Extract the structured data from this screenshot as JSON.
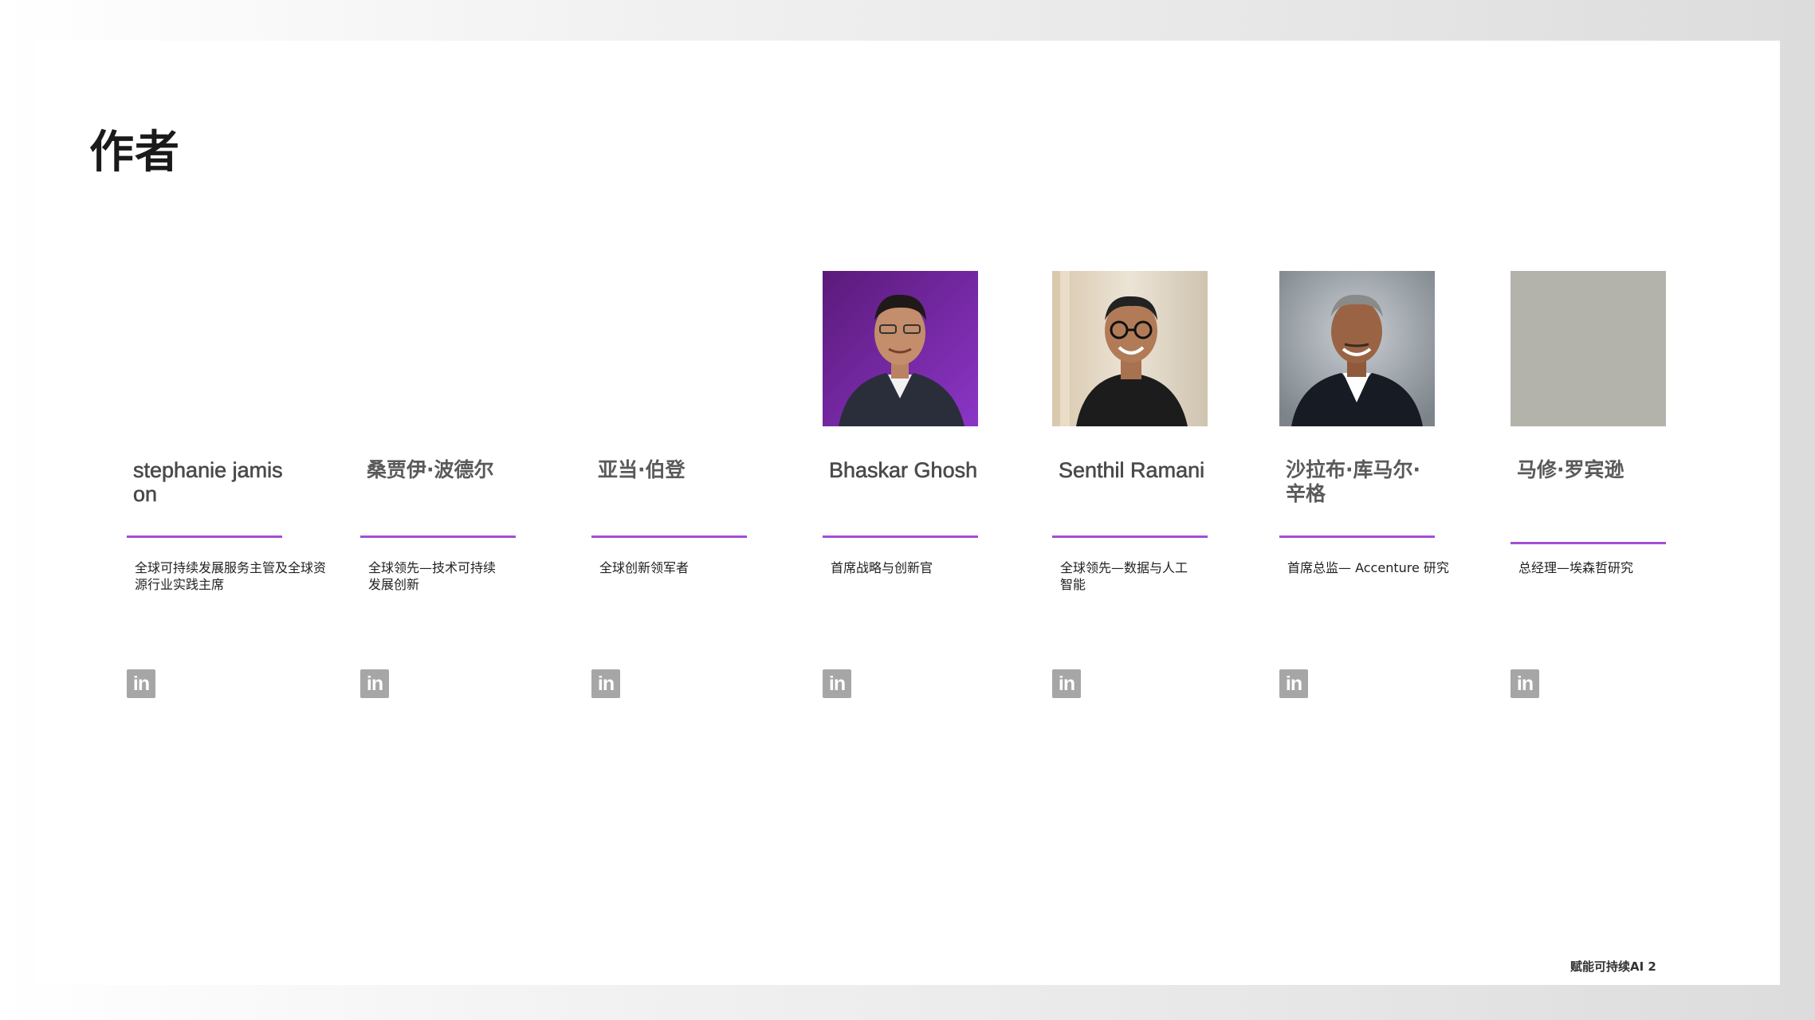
{
  "page": {
    "title": "作者",
    "footer": "赋能可持续AI 2",
    "accent_color": "#a24fd6",
    "icon_color": "#a6a6a6"
  },
  "authors": [
    {
      "name": "stephanie jamison",
      "role": "全球可持续发展服务主管及全球资源行业实践主席",
      "photo": "none",
      "linkedin_icon": "linkedin-icon"
    },
    {
      "name": "桑贾伊·波德尔",
      "role": "全球领先—技术可持续发展创新",
      "photo": "none",
      "linkedin_icon": "linkedin-icon"
    },
    {
      "name": "亚当·伯登",
      "role": "全球创新领军者",
      "photo": "none",
      "linkedin_icon": "linkedin-icon"
    },
    {
      "name": "Bhaskar Ghosh",
      "role": "首席战略与创新官",
      "photo": "portrait-purple-background",
      "linkedin_icon": "linkedin-icon"
    },
    {
      "name": "Senthil Ramani",
      "role": "全球领先—数据与人工智能",
      "photo": "portrait-light-background",
      "linkedin_icon": "linkedin-icon"
    },
    {
      "name": "沙拉布·库马尔·辛格",
      "role": "首席总监— Accenture 研究",
      "photo": "portrait-grey-background",
      "linkedin_icon": "linkedin-icon"
    },
    {
      "name": "马修·罗宾逊",
      "role": "总经理—埃森哲研究",
      "photo": "grey-placeholder",
      "linkedin_icon": "linkedin-icon"
    }
  ]
}
